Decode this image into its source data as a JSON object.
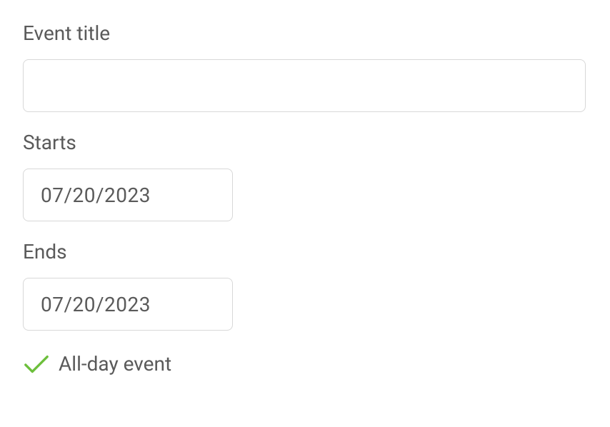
{
  "form": {
    "event_title_label": "Event title",
    "event_title_value": "",
    "starts_label": "Starts",
    "starts_value": "07/20/2023",
    "ends_label": "Ends",
    "ends_value": "07/20/2023",
    "all_day_label": "All-day event",
    "all_day_checked": true
  },
  "colors": {
    "check_green": "#6cbf3b"
  }
}
